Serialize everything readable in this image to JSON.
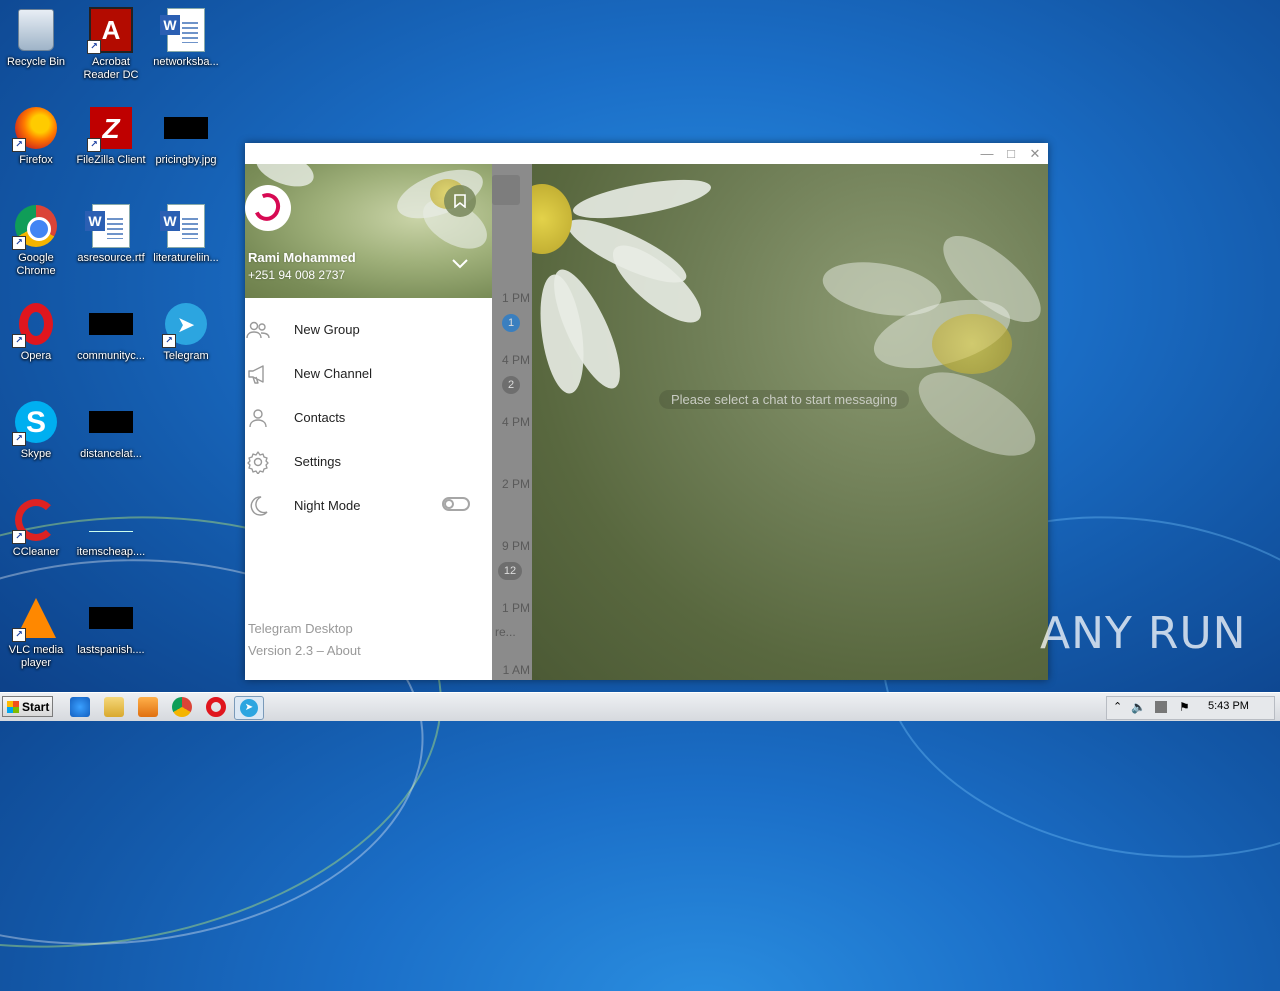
{
  "desktop": {
    "icons": [
      {
        "label": "Recycle Bin",
        "icon": "recycle-bin-icon"
      },
      {
        "label": "Acrobat Reader DC",
        "icon": "acrobat-icon"
      },
      {
        "label": "networksba...",
        "icon": "word-document-icon"
      },
      {
        "label": "Firefox",
        "icon": "firefox-icon"
      },
      {
        "label": "FileZilla Client",
        "icon": "filezilla-icon"
      },
      {
        "label": "pricingby.jpg",
        "icon": "image-file-icon"
      },
      {
        "label": "Google Chrome",
        "icon": "chrome-icon"
      },
      {
        "label": "asresource.rtf",
        "icon": "word-document-icon"
      },
      {
        "label": "literatureliin...",
        "icon": "word-document-icon"
      },
      {
        "label": "Opera",
        "icon": "opera-icon"
      },
      {
        "label": "communityc...",
        "icon": "file-icon"
      },
      {
        "label": "Telegram",
        "icon": "telegram-icon"
      },
      {
        "label": "Skype",
        "icon": "skype-icon"
      },
      {
        "label": "distancelat...",
        "icon": "file-icon"
      },
      {
        "label": "CCleaner",
        "icon": "ccleaner-icon"
      },
      {
        "label": "itemscheap....",
        "icon": "file-icon"
      },
      {
        "label": "VLC media player",
        "icon": "vlc-icon"
      },
      {
        "label": "lastspanish....",
        "icon": "file-icon"
      }
    ]
  },
  "window": {
    "controls": {
      "minimize": "—",
      "maximize": "□",
      "close": "✕"
    }
  },
  "menu": {
    "user": {
      "name": "Rami Mohammed",
      "phone": "+251 94 008 2737"
    },
    "items": [
      {
        "label": "New Group",
        "icon": "group-icon"
      },
      {
        "label": "New Channel",
        "icon": "megaphone-icon"
      },
      {
        "label": "Contacts",
        "icon": "contact-icon"
      },
      {
        "label": "Settings",
        "icon": "gear-icon"
      },
      {
        "label": "Night Mode",
        "icon": "moon-icon",
        "toggle": false
      }
    ],
    "footer": {
      "app": "Telegram Desktop",
      "version": "Version 2.3 – About"
    }
  },
  "chat_list": {
    "times": [
      "1 PM",
      "4 PM",
      "4 PM",
      "2 PM",
      "9 PM",
      "1 PM",
      "1 AM"
    ],
    "badges": [
      "1",
      "2",
      "12"
    ],
    "preview": "re..."
  },
  "chat": {
    "empty_message": "Please select a chat to start messaging"
  },
  "watermark": "ANY RUN",
  "taskbar": {
    "start_label": "Start",
    "clock": "5:43 PM"
  },
  "colors": {
    "accent": "#2ca5e0",
    "badge_blue": "#3a7fbf",
    "desktop_blue": "#1b6fc8"
  }
}
